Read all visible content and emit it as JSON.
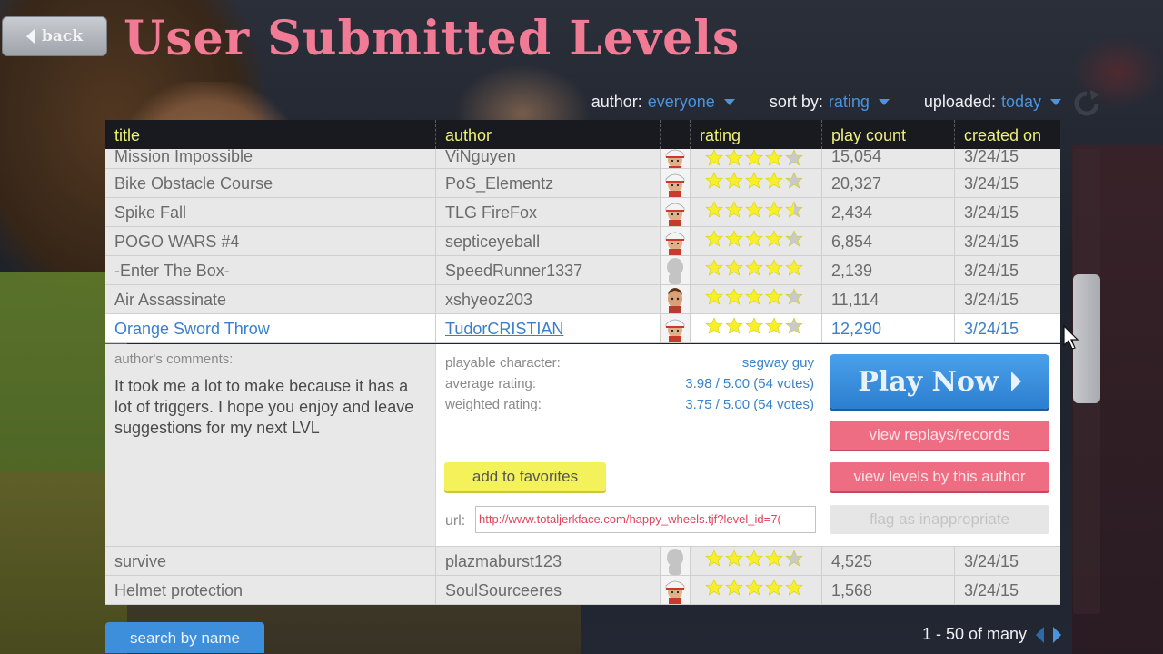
{
  "header": {
    "back_label": "back",
    "title": "User Submitted Levels"
  },
  "filters": [
    {
      "label": "author:",
      "value": "everyone"
    },
    {
      "label": "sort by:",
      "value": "rating"
    },
    {
      "label": "uploaded:",
      "value": "today"
    }
  ],
  "columns": [
    "title",
    "author",
    "",
    "rating",
    "play count",
    "created on"
  ],
  "rows_top": [
    {
      "title": "Mission Impossible",
      "author": "ViNguyen",
      "avatar": "helmet-guy",
      "stars": 4,
      "plays": "15,054",
      "created": "3/24/15"
    },
    {
      "title": "Bike Obstacle Course",
      "author": "PoS_Elementz",
      "avatar": "helmet-guy",
      "stars": 4,
      "plays": "20,327",
      "created": "3/24/15"
    },
    {
      "title": "Spike Fall",
      "author": "TLG FireFox",
      "avatar": "helmet-guy",
      "stars": 4.5,
      "plays": "2,434",
      "created": "3/24/15"
    },
    {
      "title": "POGO WARS #4",
      "author": "septiceyeball",
      "avatar": "helmet-guy",
      "stars": 4,
      "plays": "6,854",
      "created": "3/24/15"
    },
    {
      "title": "-Enter The Box-",
      "author": "SpeedRunner1337",
      "avatar": "blank",
      "stars": 5,
      "plays": "2,139",
      "created": "3/24/15"
    },
    {
      "title": "Air Assassinate",
      "author": "xshyeoz203",
      "avatar": "brown-hair",
      "stars": 4,
      "plays": "11,114",
      "created": "3/24/15"
    },
    {
      "title": "Orange Sword Throw",
      "author": "TudorCRISTIAN",
      "avatar": "helmet-guy",
      "stars": 4,
      "plays": "12,290",
      "created": "3/24/15",
      "selected": true
    }
  ],
  "details": {
    "comments_label": "author's comments:",
    "comments": "It took me a lot to make because it has a lot of triggers. I hope you enjoy and leave suggestions for my next LVL",
    "character_label": "playable character:",
    "character": "segway guy",
    "avg_label": "average rating:",
    "avg": "3.98 / 5.00 (54 votes)",
    "weighted_label": "weighted rating:",
    "weighted": "3.75 / 5.00 (54 votes)",
    "favorites_label": "add to favorites",
    "url_label": "url:",
    "url_value": "http://www.totaljerkface.com/happy_wheels.tjf?level_id=7(",
    "play_label": "Play Now",
    "replays_label": "view replays/records",
    "by_author_label": "view levels by this author",
    "flag_label": "flag as inappropriate"
  },
  "rows_bottom": [
    {
      "title": "survive",
      "author": "plazmaburst123",
      "avatar": "blank",
      "stars": 4,
      "plays": "4,525",
      "created": "3/24/15"
    },
    {
      "title": "Helmet protection",
      "author": "SoulSourceeres",
      "avatar": "helmet-guy",
      "stars": 5,
      "plays": "1,568",
      "created": "3/24/15"
    }
  ],
  "footer": {
    "search_label": "search by name",
    "pager_text": "1 - 50 of many"
  },
  "colors": {
    "title": "#f17a95",
    "accent": "#3d8fdb",
    "pink_button": "#ef6d82",
    "header_text": "#eef07a",
    "fav_button": "#f4f25a"
  }
}
